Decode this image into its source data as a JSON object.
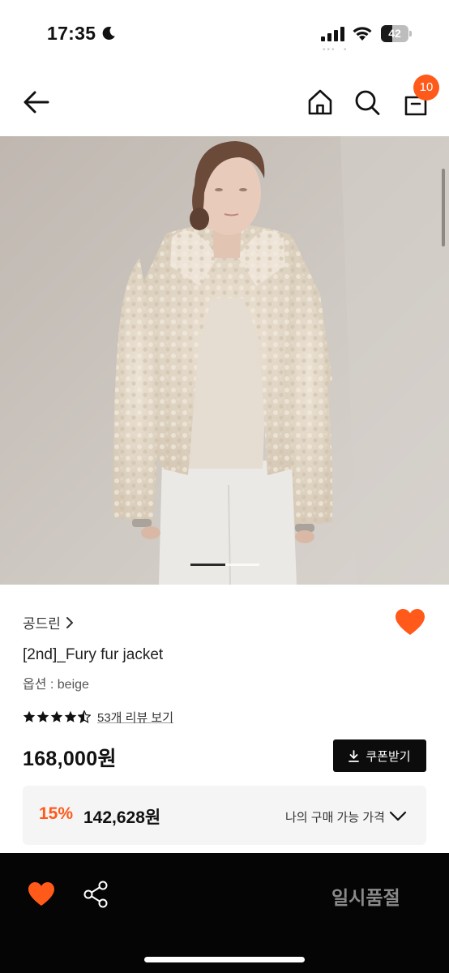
{
  "status_bar": {
    "time": "17:35",
    "battery_level": "42",
    "battery_fraction": 0.42
  },
  "header": {
    "cart_count": "10",
    "icons": [
      "back-arrow-icon",
      "home-icon",
      "search-icon",
      "shopping-bag-icon"
    ]
  },
  "product_image": {
    "carousel_pages": 2,
    "active_page": 1
  },
  "product": {
    "brand": "공드린",
    "brand_chevron": "›",
    "name": "[2nd]_Fury fur jacket",
    "option": "옵션 : beige",
    "rating": 4.5,
    "review_link": "53개 리뷰 보기",
    "price": "168,000원",
    "coupon_button": "쿠폰받기",
    "discount_rate": "15%",
    "discount_price": "142,628원",
    "my_price_label": "나의 구매 가능 가격"
  },
  "bottom_bar": {
    "soldout_label": "일시품절"
  },
  "colors": {
    "accent": "#ff5a1a",
    "bottom_bar": "#050505",
    "coupon_button": "#0c0c0c"
  }
}
